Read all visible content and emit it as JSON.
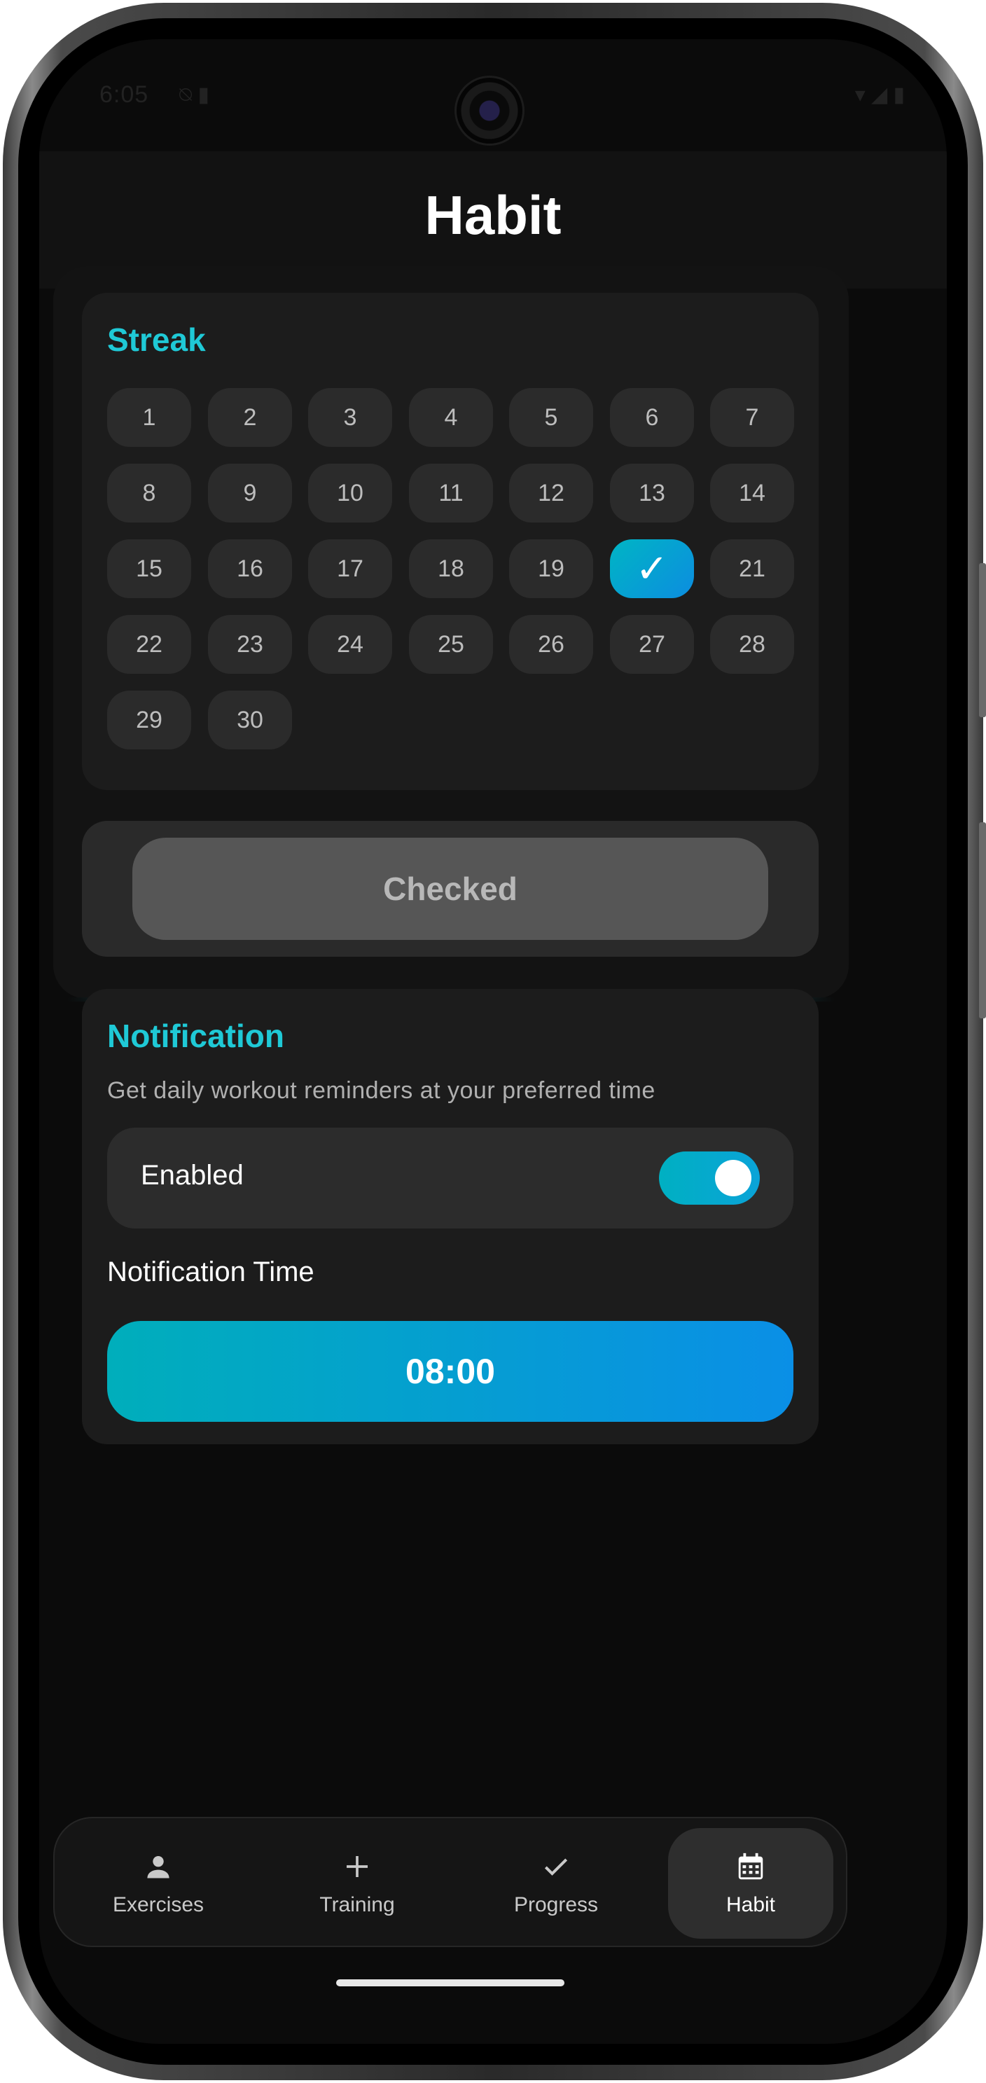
{
  "status_bar": {
    "time": "6:05",
    "left_icons": "⍉ ▮",
    "right_icons": "▾ ◢ ▮"
  },
  "header": {
    "title": "Habit"
  },
  "streak": {
    "title": "Streak",
    "days": [
      "1",
      "2",
      "3",
      "4",
      "5",
      "6",
      "7",
      "8",
      "9",
      "10",
      "11",
      "12",
      "13",
      "14",
      "15",
      "16",
      "17",
      "18",
      "19",
      "✓",
      "21",
      "22",
      "23",
      "24",
      "25",
      "26",
      "27",
      "28",
      "29",
      "30"
    ],
    "checked_day": 20
  },
  "checked_button": {
    "label": "Checked"
  },
  "notification": {
    "title": "Notification",
    "description": "Get daily workout reminders at your preferred time",
    "enabled_label": "Enabled",
    "enabled": true,
    "time_label": "Notification Time",
    "time_value": "08:00"
  },
  "nav": {
    "items": [
      {
        "label": "Exercises",
        "icon": "person-icon"
      },
      {
        "label": "Training",
        "icon": "plus-icon"
      },
      {
        "label": "Progress",
        "icon": "check-icon"
      },
      {
        "label": "Habit",
        "icon": "calendar-icon"
      }
    ],
    "active": "Habit"
  },
  "colors": {
    "accent": "#1fc9d6",
    "gradient_start": "#00b0c2",
    "gradient_end": "#0a8fe6",
    "background": "#0b0b0b",
    "card": "#1c1c1c"
  }
}
